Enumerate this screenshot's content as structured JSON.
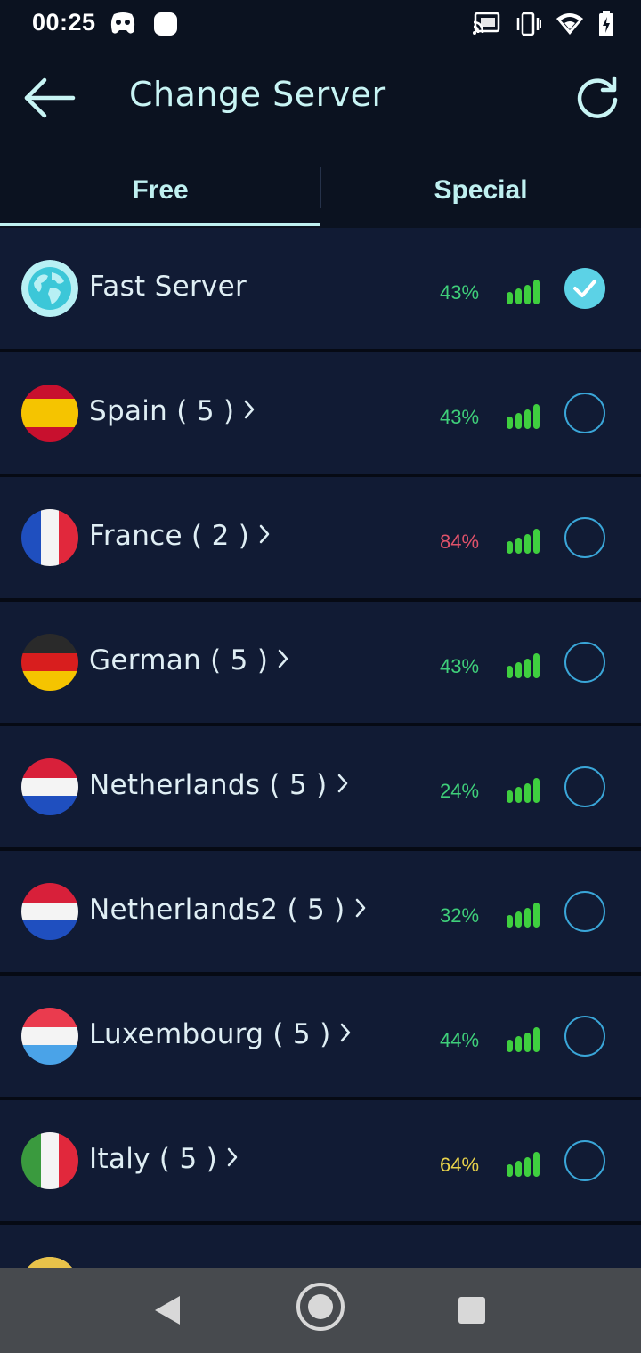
{
  "status_bar": {
    "time": "00:25",
    "left_icons": [
      "game-controller-icon",
      "notification-dot-icon"
    ],
    "right_icons": [
      "cast-icon",
      "vibrate-icon",
      "wifi-icon",
      "battery-charging-icon"
    ]
  },
  "app_bar": {
    "title": "Change Server",
    "back_icon": "arrow-left-icon",
    "refresh_icon": "refresh-icon"
  },
  "tabs": [
    {
      "label": "Free",
      "selected": true
    },
    {
      "label": "Special",
      "selected": false
    }
  ],
  "servers": [
    {
      "name": "Fast Server",
      "flag": "globe",
      "load": "43%",
      "load_color": "#3fcf7a",
      "selected": true,
      "expandable": false
    },
    {
      "name": "Spain ( 5 )",
      "flag": "spain",
      "load": "43%",
      "load_color": "#3fcf7a",
      "selected": false,
      "expandable": true
    },
    {
      "name": "France ( 2 )",
      "flag": "france",
      "load": "84%",
      "load_color": "#e0526a",
      "selected": false,
      "expandable": true
    },
    {
      "name": "German ( 5 )",
      "flag": "germany",
      "load": "43%",
      "load_color": "#3fcf7a",
      "selected": false,
      "expandable": true
    },
    {
      "name": "Netherlands ( 5 )",
      "flag": "netherlands",
      "load": "24%",
      "load_color": "#3fcf7a",
      "selected": false,
      "expandable": true
    },
    {
      "name": "Netherlands2 ( 5 )",
      "flag": "netherlands",
      "load": "32%",
      "load_color": "#3fcf7a",
      "selected": false,
      "expandable": true
    },
    {
      "name": "Luxembourg ( 5 )",
      "flag": "luxembourg",
      "load": "44%",
      "load_color": "#3fcf7a",
      "selected": false,
      "expandable": true
    },
    {
      "name": "Italy ( 5 )",
      "flag": "italy",
      "load": "64%",
      "load_color": "#e8d24a",
      "selected": false,
      "expandable": true
    }
  ],
  "colors": {
    "accent": "#bff0f0",
    "row_background": "#111b34",
    "signal_green": "#3fcf3f",
    "radio_border": "#3aa6d8",
    "radio_checked": "#5cd2e6"
  },
  "nav_bar": {
    "icons": [
      "nav-back-icon",
      "nav-home-icon",
      "nav-recents-icon"
    ]
  }
}
